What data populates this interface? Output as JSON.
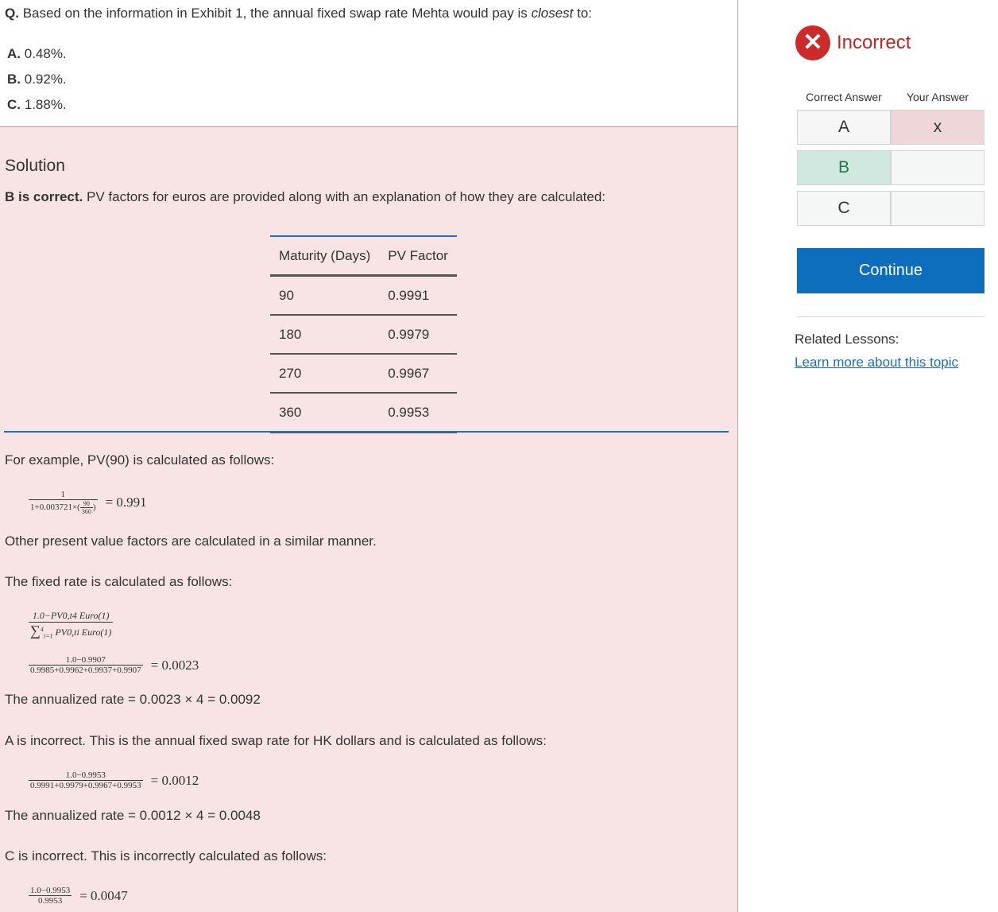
{
  "question": {
    "prefix": "Q.",
    "text_before": "Based on the information in Exhibit 1, the annual fixed swap rate Mehta would pay is",
    "emphasis": "closest",
    "text_after": "to:",
    "options": [
      {
        "letter": "A.",
        "text": "0.48%."
      },
      {
        "letter": "B.",
        "text": "0.92%."
      },
      {
        "letter": "C.",
        "text": "1.88%."
      }
    ]
  },
  "solution": {
    "title": "Solution",
    "correct_bold": "B is correct.",
    "correct_rest": "PV factors for euros are provided along with an explanation of how they are calculated:",
    "table": {
      "headers": [
        "Maturity (Days)",
        "PV Factor"
      ],
      "rows": [
        [
          "90",
          "0.9991"
        ],
        [
          "180",
          "0.9979"
        ],
        [
          "270",
          "0.9967"
        ],
        [
          "360",
          "0.9953"
        ]
      ]
    },
    "example_text": "For example, PV(90) is calculated as follows:",
    "formula1": {
      "num": "1",
      "den_prefix": "1+0.003721×(",
      "den_frac_num": "90",
      "den_frac_den": "360",
      "den_suffix": ")",
      "result": "= 0.991"
    },
    "similar_text": "Other present value factors are calculated in a similar manner.",
    "fixed_rate_text": "The fixed rate is calculated as follows:",
    "formula2": {
      "num": "1.0−PV0,t4 Euro(1)",
      "den_sigma": "∑",
      "den_sup": "4",
      "den_sub": "i=1",
      "den_rest": "PV0,ti Euro(1)"
    },
    "formula3": {
      "num": "1.0−0.9907",
      "den": "0.9985+0.9962+0.9937+0.9907",
      "result": "= 0.0023"
    },
    "annualized_b": "The annualized rate = 0.0023 × 4 = 0.0092",
    "a_text": "A is incorrect. This is the annual fixed swap rate for HK dollars and is calculated as follows:",
    "formula4": {
      "num": "1.0−0.9953",
      "den": "0.9991+0.9979+0.9967+0.9953",
      "result": "= 0.0012"
    },
    "annualized_a": "The annualized rate = 0.0012 × 4 = 0.0048",
    "c_text": "C is incorrect. This is incorrectly calculated as follows:",
    "formula5": {
      "num": "1.0−0.9953",
      "den": "0.9953",
      "result": "= 0.0047"
    }
  },
  "result_panel": {
    "status": "Incorrect",
    "status_icon": "x-circle-icon",
    "status_color": "#c02626",
    "correct_answer_header": "Correct Answer",
    "your_answer_header": "Your Answer",
    "choices": [
      {
        "letter": "A",
        "mark": "x"
      },
      {
        "letter": "B",
        "mark": ""
      },
      {
        "letter": "C",
        "mark": ""
      }
    ],
    "continue_label": "Continue",
    "continue_color": "#0d6ebe",
    "related_label": "Related Lessons:",
    "related_link": "Learn more about this topic"
  }
}
